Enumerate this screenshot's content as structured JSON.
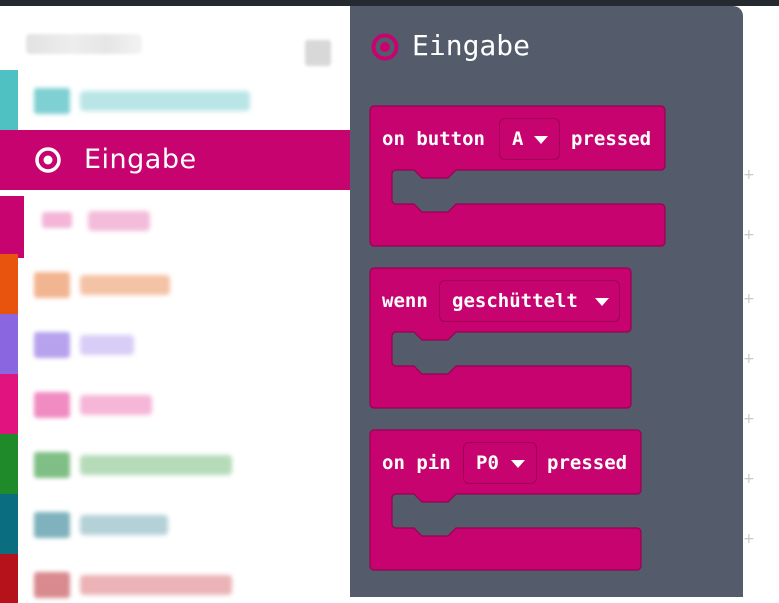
{
  "toolbox": {
    "search_placeholder": "",
    "categories": [
      {
        "id": "basic",
        "color": "#4fc1c3",
        "label_color": "#a7dfe0",
        "selected": false
      },
      {
        "id": "input",
        "color": "#c6036e",
        "label": "Eingabe",
        "selected": true
      },
      {
        "id": "music",
        "color": "#f2a6cf",
        "label_color": "#f3b2d6",
        "selected": false,
        "sub": true
      },
      {
        "id": "led",
        "color": "#e8530e",
        "label_color": "#f1b08f",
        "selected": false
      },
      {
        "id": "radio",
        "color": "#8a67e1",
        "label_color": "#c9bbf1",
        "selected": false
      },
      {
        "id": "loops",
        "color": "#e0137f",
        "label_color": "#f18fc4",
        "selected": false
      },
      {
        "id": "logic",
        "color": "#1f8a2a",
        "label_color": "#9ccda0",
        "selected": false
      },
      {
        "id": "variables",
        "color": "#0b6d80",
        "label_color": "#8fbcc6",
        "selected": false
      },
      {
        "id": "math",
        "color": "#b5121b",
        "label_color": "#e29a9e",
        "selected": false
      }
    ]
  },
  "flyout": {
    "title": "Eingabe",
    "icon": "target-icon",
    "blocks": [
      {
        "id": "on-button-pressed",
        "prefix": "on button",
        "dropdown": "A",
        "suffix": "pressed"
      },
      {
        "id": "on-gesture",
        "prefix": "wenn",
        "dropdown": "geschüttelt",
        "suffix": ""
      },
      {
        "id": "on-pin-pressed",
        "prefix": "on pin",
        "dropdown": "P0",
        "suffix": "pressed"
      }
    ]
  },
  "colors": {
    "input_category": "#c6036e",
    "flyout_background": "#545b6b",
    "top_bar": "#252a31"
  }
}
